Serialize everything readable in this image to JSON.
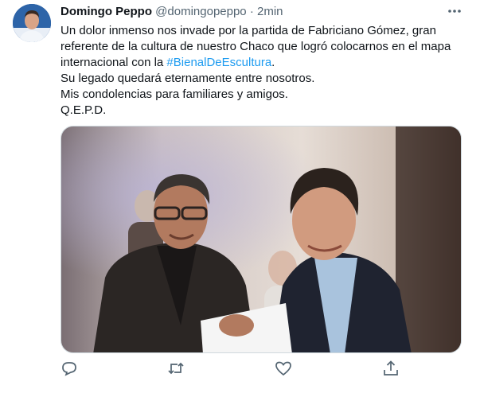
{
  "tweet": {
    "author_name": "Domingo Peppo",
    "author_handle": "@domingopeppo",
    "separator": "·",
    "time": "2min",
    "text_lines": [
      "Un dolor inmenso nos invade por la partida de Fabriciano Gómez, gran",
      "referente de la cultura de nuestro Chaco que logró colocarnos en el mapa",
      "internacional con la "
    ],
    "hashtag": "#BienalDeEscultura",
    "hashtag_suffix": ".",
    "text_lines_after": [
      "Su legado quedará eternamente entre nosotros.",
      "Mis condolencias para familiares y amigos.",
      "Q.E.P.D."
    ]
  },
  "icons": {
    "more": "more-icon",
    "reply": "reply-icon",
    "retweet": "retweet-icon",
    "like": "like-icon",
    "share": "share-icon"
  },
  "colors": {
    "text": "#0f1419",
    "secondary": "#536471",
    "link": "#1d9bf0",
    "border": "#cfd9de"
  }
}
